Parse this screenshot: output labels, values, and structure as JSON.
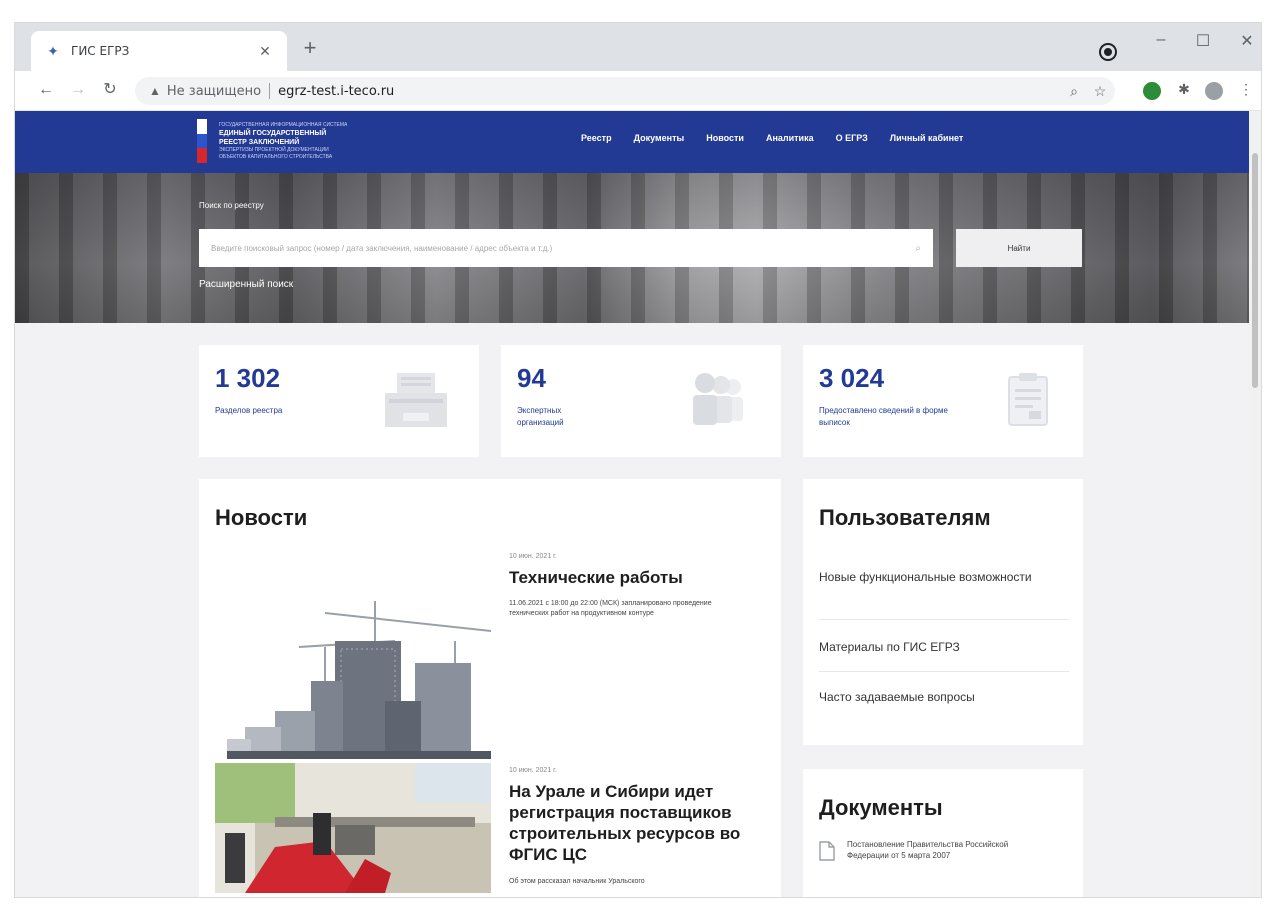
{
  "browser": {
    "tab_title": "ГИС ЕГРЗ",
    "security_label": "Не защищено",
    "url": "egrz-test.i-teco.ru"
  },
  "site": {
    "logo_small_top": "ГОСУДАРСТВЕННАЯ ИНФОРМАЦИОННАЯ СИСТЕМА",
    "logo_line1": "ЕДИНЫЙ ГОСУДАРСТВЕННЫЙ",
    "logo_line2": "РЕЕСТР ЗАКЛЮЧЕНИЙ",
    "logo_small_1": "ЭКСПЕРТИЗЫ ПРОЕКТНОЙ ДОКУМЕНТАЦИИ",
    "logo_small_2": "ОБЪЕКТОВ КАПИТАЛЬНОГО СТРОИТЕЛЬСТВА",
    "nav": [
      "Реестр",
      "Документы",
      "Новости",
      "Аналитика",
      "О ЕГРЗ",
      "Личный кабинет"
    ],
    "flag_colors": [
      "#ffffff",
      "#2d54c9",
      "#d8262d"
    ]
  },
  "hero": {
    "search_label": "Поиск по реестру",
    "search_placeholder": "Введите поисковый запрос (номер / дата заключения, наименование / адрес объекта и т.д.)",
    "find_button": "Найти",
    "advanced_search": "Расширенный поиск"
  },
  "stats": [
    {
      "value": "1 302",
      "label": "Разделов реестра",
      "icon": "printer-icon"
    },
    {
      "value": "94",
      "label": "Экспертных организаций",
      "icon": "people-icon"
    },
    {
      "value": "3 024",
      "label": "Предоставлено сведений в форме выписок",
      "icon": "document-icon"
    }
  ],
  "news": {
    "title": "Новости",
    "items": [
      {
        "date": "10 июн. 2021 г.",
        "title": "Технические работы",
        "desc": "11.06.2021 с 18:00 до 22:00 (МСК) запланировано проведение технических работ на продуктивном контуре"
      },
      {
        "date": "10 июн. 2021 г.",
        "title": "На Урале и Сибири идет регистрация поставщиков строительных ресурсов во ФГИС ЦС",
        "desc": "Об этом рассказал начальник Уральского"
      }
    ]
  },
  "users": {
    "title": "Пользователям",
    "links": [
      "Новые функциональные возможности",
      "Материалы по ГИС ЕГРЗ",
      "Часто задаваемые вопросы"
    ]
  },
  "documents": {
    "title": "Документы",
    "item": "Постановление Правительства Российской Федерации от 5 марта 2007"
  },
  "colors": {
    "brand_blue": "#233a95",
    "page_bg": "#f2f2f4"
  }
}
